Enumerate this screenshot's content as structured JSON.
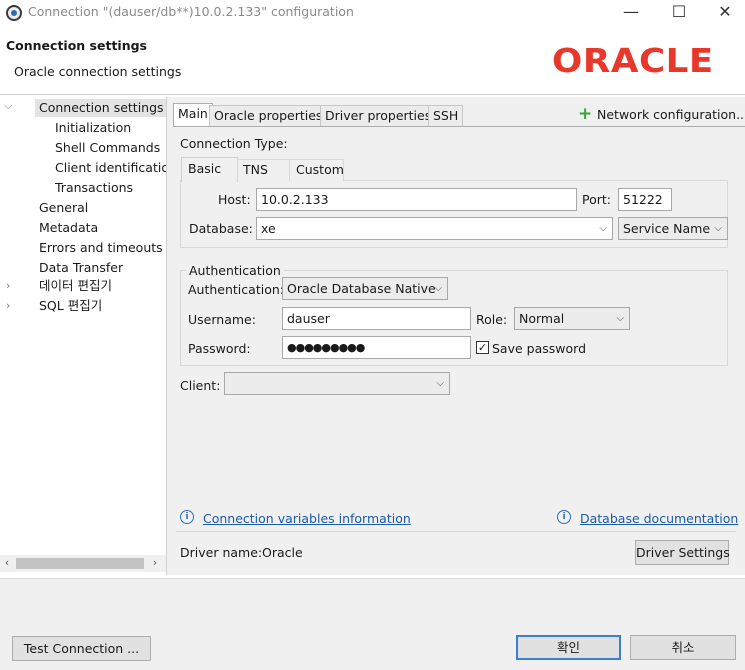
{
  "window": {
    "title": "Connection \"(dauser/db**)10.0.2.133\" configuration",
    "minimize": "—",
    "maximize": "☐",
    "close": "✕"
  },
  "header": {
    "title": "Connection settings",
    "subtitle": "Oracle connection settings",
    "logo_text": "ORACLE",
    "logo_color": "#e8382b"
  },
  "tree": {
    "items": [
      {
        "label": "Connection settings",
        "selected": true
      },
      {
        "label": "Initialization"
      },
      {
        "label": "Shell Commands"
      },
      {
        "label": "Client identificatior"
      },
      {
        "label": "Transactions"
      },
      {
        "label": "General"
      },
      {
        "label": "Metadata"
      },
      {
        "label": "Errors and timeouts"
      },
      {
        "label": "Data Transfer"
      },
      {
        "label": "데이터 편집기"
      },
      {
        "label": "SQL 편집기"
      }
    ]
  },
  "tabs": {
    "items": [
      "Main",
      "Oracle properties",
      "Driver properties",
      "SSH"
    ],
    "network_config": "Network configuration..."
  },
  "connection_type": {
    "label": "Connection Type:",
    "tabs": [
      "Basic",
      "TNS",
      "Custom"
    ]
  },
  "form": {
    "host_label": "Host:",
    "host_value": "10.0.2.133",
    "port_label": "Port:",
    "port_value": "51222",
    "database_label": "Database:",
    "database_value": "xe",
    "database_type": "Service Name"
  },
  "auth": {
    "group_label": "Authentication",
    "auth_label": "Authentication:",
    "auth_value": "Oracle Database Native",
    "username_label": "Username:",
    "username_value": "dauser",
    "role_label": "Role:",
    "role_value": "Normal",
    "password_label": "Password:",
    "password_value": "●●●●●●●●●",
    "save_password_label": "Save password",
    "save_password_checked": "✓"
  },
  "client": {
    "label": "Client:",
    "value": ""
  },
  "links": {
    "conn_vars": "Connection variables information",
    "db_docs": "Database documentation"
  },
  "driver": {
    "label": "Driver name:",
    "value": "Oracle",
    "settings_button": "Driver Settings"
  },
  "footer": {
    "test_button": "Test Connection ...",
    "ok_button": "확인",
    "cancel_button": "취소"
  }
}
